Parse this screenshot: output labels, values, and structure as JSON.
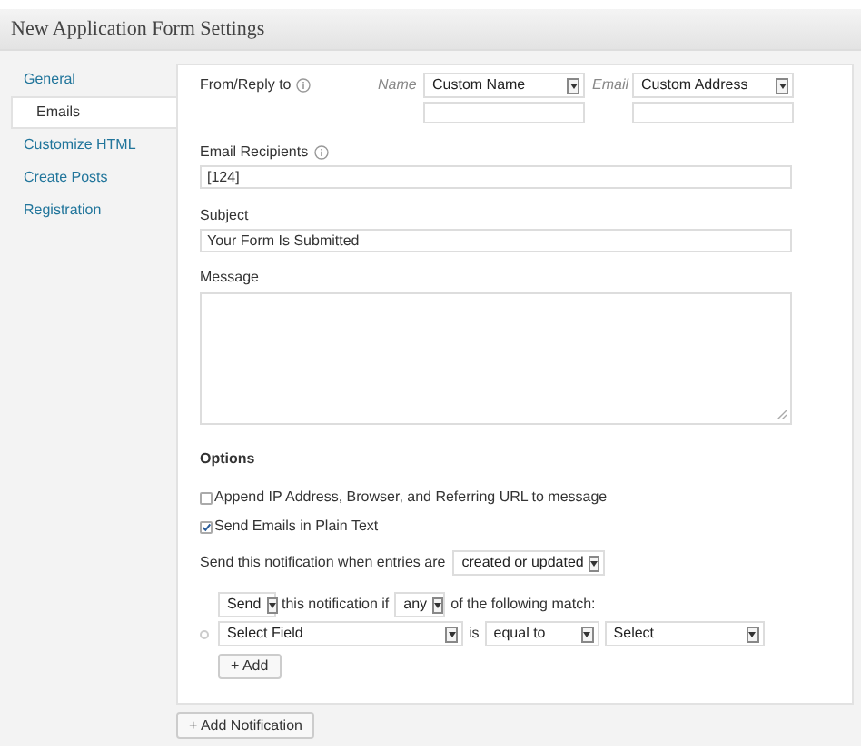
{
  "title": "New Application Form Settings",
  "sidebar": {
    "items": [
      {
        "label": "General",
        "selected": false
      },
      {
        "label": "Emails",
        "selected": true
      },
      {
        "label": "Customize HTML",
        "selected": false
      },
      {
        "label": "Create Posts",
        "selected": false
      },
      {
        "label": "Registration",
        "selected": false
      }
    ]
  },
  "from_reply": {
    "label": "From/Reply to",
    "name_label": "Name",
    "name_select": "Custom Name",
    "email_label": "Email",
    "email_select": "Custom Address"
  },
  "email_recipients": {
    "label": "Email Recipients",
    "value": "[124]"
  },
  "subject": {
    "label": "Subject",
    "value": "Your Form Is Submitted"
  },
  "message": {
    "label": "Message"
  },
  "options": {
    "heading": "Options",
    "checkboxes": [
      {
        "label": "Append IP Address, Browser, and Referring URL to message",
        "checked": false
      },
      {
        "label": "Send Emails in Plain Text",
        "checked": true
      }
    ]
  },
  "trigger": {
    "label": "Send this notification when entries are",
    "select": "created or updated"
  },
  "conditions": {
    "action_select": "Send",
    "text_1": "this notification if",
    "match_select": "any",
    "text_2": "of the following match:",
    "rule": {
      "field_select": "Select Field",
      "operator_text": "is",
      "operator_select": "equal to",
      "value_select": "Select"
    },
    "add_button": "+ Add"
  },
  "add_notification_button": "+ Add Notification"
}
